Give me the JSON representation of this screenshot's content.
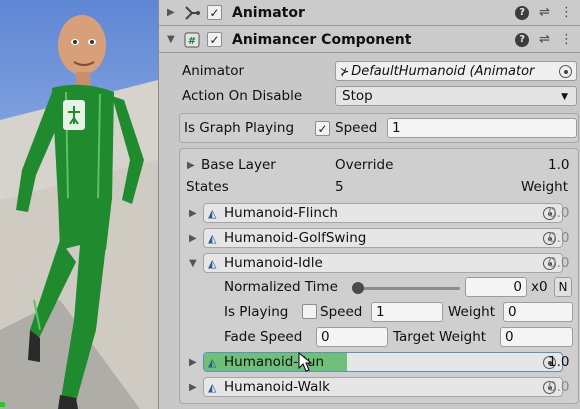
{
  "components": {
    "animator": {
      "title": "Animator",
      "enabled": true
    },
    "animancer": {
      "title": "Animancer Component",
      "enabled": true
    }
  },
  "fields": {
    "animator_label": "Animator",
    "animator_value": "DefaultHumanoid (Animator",
    "action_on_disable_label": "Action On Disable",
    "action_on_disable_value": "Stop",
    "is_graph_playing_label": "Is Graph Playing",
    "is_graph_playing": true,
    "speed_label": "Speed",
    "speed_value": "1"
  },
  "layer": {
    "name": "Base Layer",
    "mode": "Override",
    "weight": "1.0",
    "states_label": "States",
    "states_count": "5",
    "weight_header": "Weight"
  },
  "states": [
    {
      "name": "Humanoid-Flinch",
      "weight": "0.0"
    },
    {
      "name": "Humanoid-GolfSwing",
      "weight": "0.0"
    },
    {
      "name": "Humanoid-Idle",
      "weight": "0.0"
    },
    {
      "name": "Humanoid-Run",
      "weight": "1.0",
      "progress": 0.4
    },
    {
      "name": "Humanoid-Walk",
      "weight": "0.0"
    }
  ],
  "idle_details": {
    "normalized_time_label": "Normalized Time",
    "normalized_time_value": "0",
    "multiplier": "x0",
    "n_button": "N",
    "is_playing_label": "Is Playing",
    "is_playing": false,
    "speed_label": "Speed",
    "speed_value": "1",
    "weight_label": "Weight",
    "weight_value": "0",
    "fade_speed_label": "Fade Speed",
    "fade_speed_value": "0",
    "target_weight_label": "Target Weight",
    "target_weight_value": "0"
  },
  "colors": {
    "panel_bg": "#c8c8c8",
    "run_progress": "#6fbf78",
    "character_suit": "#1f8a2e"
  }
}
